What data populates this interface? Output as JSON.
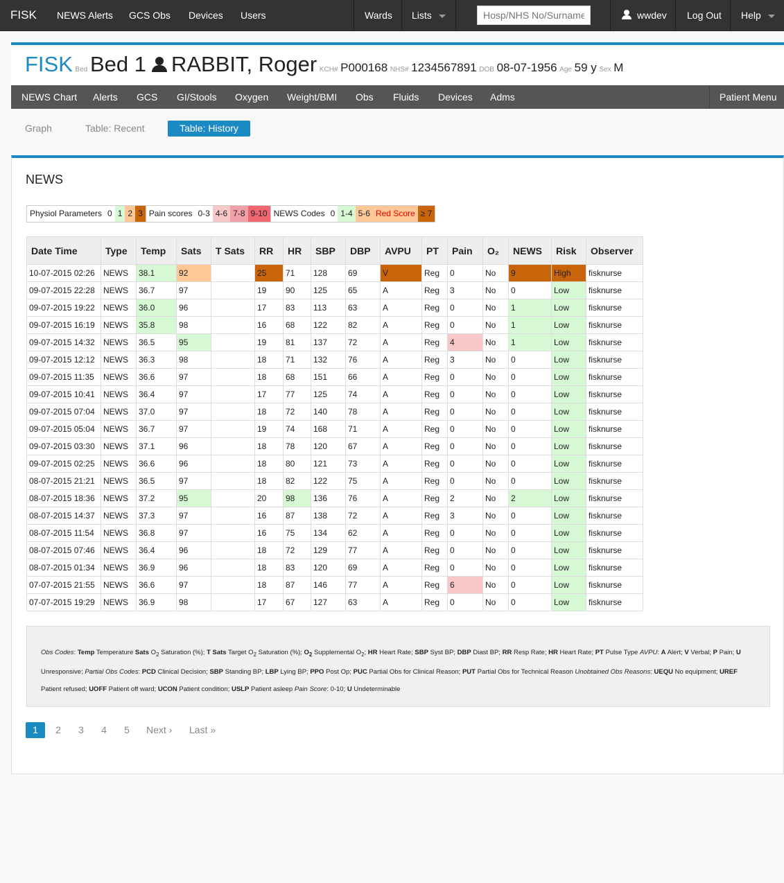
{
  "navbar": {
    "brand": "FISK",
    "links": [
      "NEWS Alerts",
      "GCS Obs",
      "Devices",
      "Users"
    ],
    "wards": "Wards",
    "lists": "Lists",
    "search_placeholder": "Hosp/NHS No/Surname",
    "user": "wwdev",
    "logout": "Log Out",
    "help": "Help"
  },
  "patient": {
    "app": "FISK",
    "bed_label": "Bed",
    "bed": "Bed 1",
    "name": "RABBIT, Roger",
    "kch_label": "KCH#",
    "kch": "P000168",
    "nhs_label": "NHS#",
    "nhs": "1234567891",
    "dob_label": "DOB",
    "dob": "08-07-1956",
    "age_label": "Age",
    "age": "59 y",
    "sex_label": "Sex",
    "sex": "M"
  },
  "subnav": {
    "items": [
      "NEWS Chart",
      "Alerts",
      "GCS",
      "GI/Stools",
      "Oxygen",
      "Weight/BMI",
      "Obs",
      "Fluids",
      "Devices",
      "Adms"
    ],
    "patient_menu": "Patient Menu"
  },
  "tabs": [
    "Graph",
    "Table: Recent",
    "Table: History"
  ],
  "panel_title": "NEWS",
  "legend": {
    "physiol_label": "Physiol Parameters",
    "physiol": [
      "0",
      "1",
      "2",
      "3"
    ],
    "pain_label": "Pain scores",
    "pain": [
      "0-3",
      "4-6",
      "7-8",
      "9-10"
    ],
    "news_label": "NEWS Codes",
    "news": [
      "0",
      "1-4",
      "5-6",
      "Red Score",
      "≥ 7"
    ]
  },
  "table": {
    "headers": [
      "Date Time",
      "Type",
      "Temp",
      "Sats",
      "T Sats",
      "RR",
      "HR",
      "SBP",
      "DBP",
      "AVPU",
      "PT",
      "Pain",
      "O₂",
      "NEWS",
      "Risk",
      "Observer"
    ],
    "rows": [
      [
        "10-07-2015 02:26",
        "NEWS",
        "38.1",
        "92",
        "",
        "25",
        "71",
        "128",
        "69",
        "V",
        "Reg",
        "0",
        "No",
        "9",
        "High",
        "fisknurse"
      ],
      [
        "09-07-2015 22:28",
        "NEWS",
        "36.7",
        "97",
        "",
        "19",
        "90",
        "125",
        "65",
        "A",
        "Reg",
        "3",
        "No",
        "0",
        "Low",
        "fisknurse"
      ],
      [
        "09-07-2015 19:22",
        "NEWS",
        "36.0",
        "96",
        "",
        "17",
        "83",
        "113",
        "63",
        "A",
        "Reg",
        "0",
        "No",
        "1",
        "Low",
        "fisknurse"
      ],
      [
        "09-07-2015 16:19",
        "NEWS",
        "35.8",
        "98",
        "",
        "16",
        "68",
        "122",
        "82",
        "A",
        "Reg",
        "0",
        "No",
        "1",
        "Low",
        "fisknurse"
      ],
      [
        "09-07-2015 14:32",
        "NEWS",
        "36.5",
        "95",
        "",
        "19",
        "81",
        "137",
        "72",
        "A",
        "Reg",
        "4",
        "No",
        "1",
        "Low",
        "fisknurse"
      ],
      [
        "09-07-2015 12:12",
        "NEWS",
        "36.3",
        "98",
        "",
        "18",
        "71",
        "132",
        "76",
        "A",
        "Reg",
        "3",
        "No",
        "0",
        "Low",
        "fisknurse"
      ],
      [
        "09-07-2015 11:35",
        "NEWS",
        "36.6",
        "97",
        "",
        "18",
        "68",
        "151",
        "66",
        "A",
        "Reg",
        "0",
        "No",
        "0",
        "Low",
        "fisknurse"
      ],
      [
        "09-07-2015 10:41",
        "NEWS",
        "36.4",
        "97",
        "",
        "17",
        "77",
        "125",
        "74",
        "A",
        "Reg",
        "0",
        "No",
        "0",
        "Low",
        "fisknurse"
      ],
      [
        "09-07-2015 07:04",
        "NEWS",
        "37.0",
        "97",
        "",
        "18",
        "72",
        "140",
        "78",
        "A",
        "Reg",
        "0",
        "No",
        "0",
        "Low",
        "fisknurse"
      ],
      [
        "09-07-2015 05:04",
        "NEWS",
        "36.7",
        "97",
        "",
        "19",
        "74",
        "168",
        "71",
        "A",
        "Reg",
        "0",
        "No",
        "0",
        "Low",
        "fisknurse"
      ],
      [
        "09-07-2015 03:30",
        "NEWS",
        "37.1",
        "96",
        "",
        "18",
        "78",
        "120",
        "67",
        "A",
        "Reg",
        "0",
        "No",
        "0",
        "Low",
        "fisknurse"
      ],
      [
        "09-07-2015 02:25",
        "NEWS",
        "36.6",
        "96",
        "",
        "18",
        "80",
        "121",
        "73",
        "A",
        "Reg",
        "0",
        "No",
        "0",
        "Low",
        "fisknurse"
      ],
      [
        "08-07-2015 21:21",
        "NEWS",
        "36.5",
        "97",
        "",
        "18",
        "82",
        "122",
        "75",
        "A",
        "Reg",
        "0",
        "No",
        "0",
        "Low",
        "fisknurse"
      ],
      [
        "08-07-2015 18:36",
        "NEWS",
        "37.2",
        "95",
        "",
        "20",
        "98",
        "136",
        "76",
        "A",
        "Reg",
        "2",
        "No",
        "2",
        "Low",
        "fisknurse"
      ],
      [
        "08-07-2015 14:37",
        "NEWS",
        "37.3",
        "97",
        "",
        "16",
        "87",
        "138",
        "72",
        "A",
        "Reg",
        "3",
        "No",
        "0",
        "Low",
        "fisknurse"
      ],
      [
        "08-07-2015 11:54",
        "NEWS",
        "36.8",
        "97",
        "",
        "16",
        "75",
        "134",
        "62",
        "A",
        "Reg",
        "0",
        "No",
        "0",
        "Low",
        "fisknurse"
      ],
      [
        "08-07-2015 07:46",
        "NEWS",
        "36.4",
        "96",
        "",
        "18",
        "72",
        "129",
        "77",
        "A",
        "Reg",
        "0",
        "No",
        "0",
        "Low",
        "fisknurse"
      ],
      [
        "08-07-2015 01:34",
        "NEWS",
        "36.9",
        "96",
        "",
        "18",
        "83",
        "120",
        "69",
        "A",
        "Reg",
        "0",
        "No",
        "0",
        "Low",
        "fisknurse"
      ],
      [
        "07-07-2015 21:55",
        "NEWS",
        "36.6",
        "97",
        "",
        "18",
        "87",
        "146",
        "77",
        "A",
        "Reg",
        "6",
        "No",
        "0",
        "Low",
        "fisknurse"
      ],
      [
        "07-07-2015 19:29",
        "NEWS",
        "36.9",
        "98",
        "",
        "17",
        "67",
        "127",
        "63",
        "A",
        "Reg",
        "0",
        "No",
        "0",
        "Low",
        "fisknurse"
      ]
    ],
    "highlights": [
      {
        "row": 0,
        "col": 2,
        "level": "green"
      },
      {
        "row": 0,
        "col": 3,
        "level": "orange"
      },
      {
        "row": 0,
        "col": 5,
        "level": "dark"
      },
      {
        "row": 0,
        "col": 9,
        "level": "dark"
      },
      {
        "row": 0,
        "col": 13,
        "level": "dark"
      },
      {
        "row": 0,
        "col": 14,
        "level": "dark"
      },
      {
        "row": 2,
        "col": 2,
        "level": "green"
      },
      {
        "row": 2,
        "col": 13,
        "level": "green"
      },
      {
        "row": 3,
        "col": 2,
        "level": "green"
      },
      {
        "row": 3,
        "col": 13,
        "level": "green"
      },
      {
        "row": 4,
        "col": 3,
        "level": "green"
      },
      {
        "row": 4,
        "col": 11,
        "level": "pink"
      },
      {
        "row": 4,
        "col": 13,
        "level": "green"
      },
      {
        "row": 13,
        "col": 3,
        "level": "green"
      },
      {
        "row": 13,
        "col": 6,
        "level": "green"
      },
      {
        "row": 13,
        "col": 13,
        "level": "green"
      },
      {
        "row": 18,
        "col": 11,
        "level": "pink"
      }
    ],
    "low_risk_color": "#d6f8d4"
  },
  "codes": {
    "line1": "Obs Codes: Temp Temperature Sats O₂ Saturation (%); T Sats Target O₂ Saturation (%); O₂ Supplemental O₂; HR Heart Rate; SBP Syst BP; DBP Diast BP; RR Resp Rate; HR Heart Rate; PT Pulse Type AVPU: A Alert; V Verbal; P Pain; U",
    "line2": "Unresponsive; Partial Obs Codes: PCD Clinical Decision; SBP Standing BP; LBP Lying BP; PPO Post Op; PUC Partial Obs for Clinical Reason; PUT Partial Obs for Technical Reason Unobtained Obs Reasons: UEQU No equipment; UREF",
    "line3": "Patient refused; UOFF Patient off ward; UCON Patient condition; USLP Patient asleep Pain Score: 0-10; U Undeterminable"
  },
  "pagination": {
    "pages": [
      "1",
      "2",
      "3",
      "4",
      "5"
    ],
    "next": "Next ›",
    "last": "Last »",
    "current": "1"
  },
  "colors": {
    "accent": "#1b8ac2",
    "navbar": "#333333",
    "subnav": "#555555",
    "score_green": "#d6f8d4",
    "score_orange": "#fdc896",
    "score_dark": "#c8640a",
    "pain_pink": "#f8c8c8"
  }
}
